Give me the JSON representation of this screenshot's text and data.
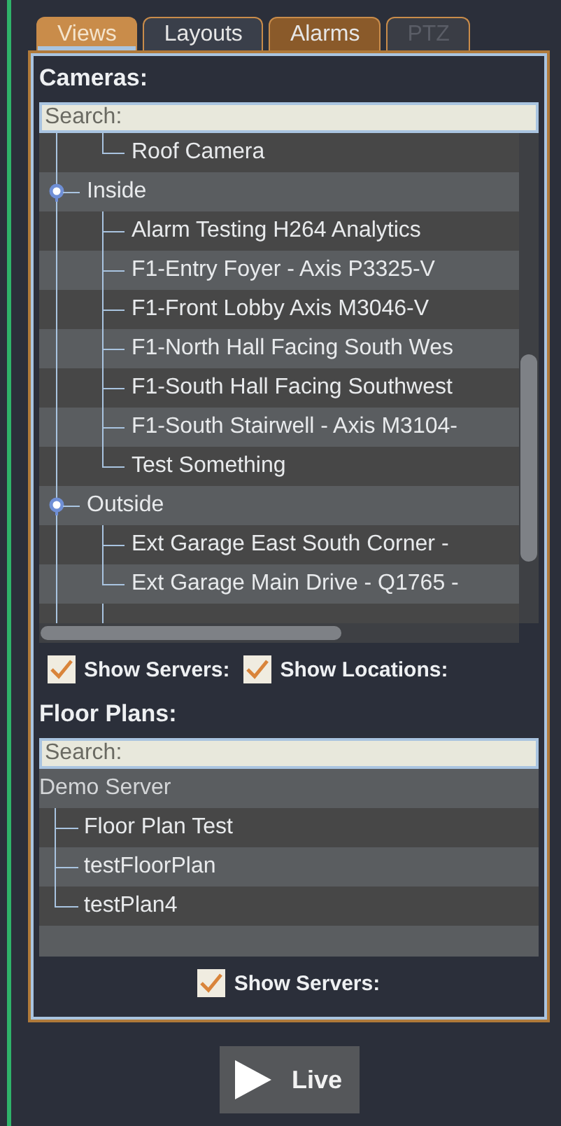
{
  "tabs": [
    {
      "label": "Views",
      "selected": true,
      "disabled": false,
      "color": "#c98c4a"
    },
    {
      "label": "Layouts",
      "selected": false,
      "disabled": false,
      "color": "#3a3f4a"
    },
    {
      "label": "Alarms",
      "selected": false,
      "disabled": false,
      "color": "#8a5a2a"
    },
    {
      "label": "PTZ",
      "selected": false,
      "disabled": true,
      "color": "#3a3d45"
    }
  ],
  "cameras": {
    "title": "Cameras:",
    "search": {
      "placeholder": "Search:"
    },
    "tree": [
      {
        "children": [
          {
            "label": "Roof Camera"
          }
        ]
      },
      {
        "label": "Inside",
        "expanded": true,
        "children": [
          {
            "label": "Alarm Testing H264 Analytics"
          },
          {
            "label": "F1-Entry Foyer - Axis P3325-V"
          },
          {
            "label": "F1-Front Lobby Axis M3046-V"
          },
          {
            "label": "F1-North Hall Facing South Wes"
          },
          {
            "label": "F1-South Hall Facing Southwest"
          },
          {
            "label": "F1-South Stairwell - Axis M3104-"
          },
          {
            "label": "Test Something"
          }
        ]
      },
      {
        "label": "Outside",
        "expanded": true,
        "children": [
          {
            "label": "Ext Garage East South Corner -"
          },
          {
            "label": "Ext Garage Main Drive - Q1765 -"
          }
        ]
      }
    ],
    "options": [
      {
        "label": "Show Servers:",
        "checked": true
      },
      {
        "label": "Show Locations:",
        "checked": true
      }
    ]
  },
  "floor_plans": {
    "title": "Floor Plans:",
    "search": {
      "placeholder": "Search:"
    },
    "tree": [
      {
        "label": "Demo Server",
        "children": [
          {
            "label": "Floor Plan Test"
          },
          {
            "label": "testFloorPlan"
          },
          {
            "label": "testPlan4"
          }
        ]
      }
    ],
    "options": [
      {
        "label": "Show Servers:",
        "checked": true
      }
    ]
  },
  "live_button": {
    "label": "Live"
  }
}
